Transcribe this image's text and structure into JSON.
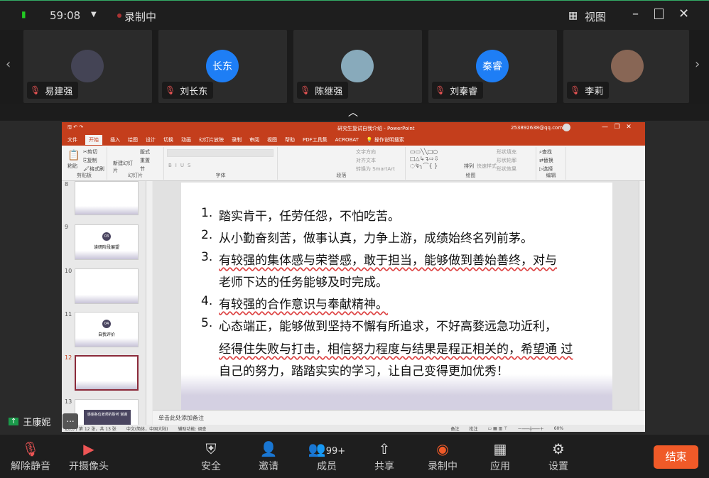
{
  "topbar": {
    "timer": "59:08",
    "recording": "录制中",
    "view": "视图"
  },
  "participants": [
    {
      "name": "易建强",
      "avatar": "photo"
    },
    {
      "name": "刘长东",
      "avatar": "长东",
      "color": "#1e7ef5"
    },
    {
      "name": "陈继强",
      "avatar": "photo"
    },
    {
      "name": "刘秦睿",
      "avatar": "秦睿",
      "color": "#1e7ef5"
    },
    {
      "name": "李莉",
      "avatar": "photo"
    }
  ],
  "sharer": {
    "name": "王康妮",
    "more": "..."
  },
  "ppt": {
    "title": "研究生复试自我介绍 - PowerPoint",
    "account": "253892638@qq.com",
    "tabs": [
      "文件",
      "开始",
      "插入",
      "绘图",
      "设计",
      "切换",
      "动画",
      "幻灯片放映",
      "录制",
      "审阅",
      "视图",
      "帮助",
      "PDF工具集",
      "ACROBAT"
    ],
    "search": "操作说明搜索",
    "groups": {
      "clipboard": "剪贴板",
      "paste": "粘贴",
      "cut": "剪切",
      "copy": "复制",
      "format": "格式刷",
      "slides": "幻灯片",
      "new_slide": "新建幻灯片",
      "layout": "版式",
      "reset": "重置",
      "section": "节",
      "font": "字体",
      "paragraph": "段落",
      "text_dir": "文字方向",
      "align_text": "对齐文本",
      "smartart": "转换为 SmartArt",
      "drawing": "绘图",
      "arrange": "排列",
      "quick_style": "快速样式",
      "fill": "形状填充",
      "outline": "形状轮廓",
      "effect": "形状效果",
      "editing": "编辑",
      "find": "查找",
      "replace": "替换",
      "select": "选择"
    },
    "thumbs": [
      {
        "n": "8",
        "title": ""
      },
      {
        "n": "9",
        "title": "读研阶段展望",
        "badge": "03"
      },
      {
        "n": "10",
        "title": ""
      },
      {
        "n": "11",
        "title": "自我评价",
        "badge": "04"
      },
      {
        "n": "12",
        "title": ""
      },
      {
        "n": "13",
        "title": "感谢各位老师的聆听 谢谢"
      }
    ],
    "slide_lines": [
      {
        "num": "1.",
        "text": "踏实肯干，任劳任怨，不怕吃苦。"
      },
      {
        "num": "2.",
        "text": "从小勤奋刻苦，做事认真，力争上游，成绩始终名列前茅。"
      },
      {
        "num": "3.",
        "text": "有较强的集体感与荣誉感，敢于担当，能够做到善始善终，对与"
      },
      {
        "num": "",
        "text": "老师下达的任务能够及时完成。"
      },
      {
        "num": "4.",
        "text": "有较强的合作意识与奉献精神。"
      },
      {
        "num": "5.",
        "text": "心态端正，能够做到坚持不懈有所追求，不好高婺远急功近利，"
      },
      {
        "num": "",
        "text": "经得住失败与打击，相信努力程度与结果是程正相关的，希望通 过"
      },
      {
        "num": "",
        "text": "自己的努力，踏踏实实的学习，让自己变得更加优秀！"
      }
    ],
    "notes": "单击此处添加备注",
    "status": {
      "slide": "幻灯片 第 12 张，共 13 张",
      "lang": "中文(简体，中国大陆)",
      "access": "辅助功能: 调查",
      "notes_btn": "备注",
      "comments_btn": "批注",
      "zoom": "60%"
    }
  },
  "toolbar": {
    "unmute": "解除静音",
    "camera": "开摄像头",
    "security": "安全",
    "invite": "邀请",
    "members": "成员",
    "members_count": "99+",
    "share": "共享",
    "recording": "录制中",
    "apps": "应用",
    "settings": "设置",
    "end": "结束"
  }
}
